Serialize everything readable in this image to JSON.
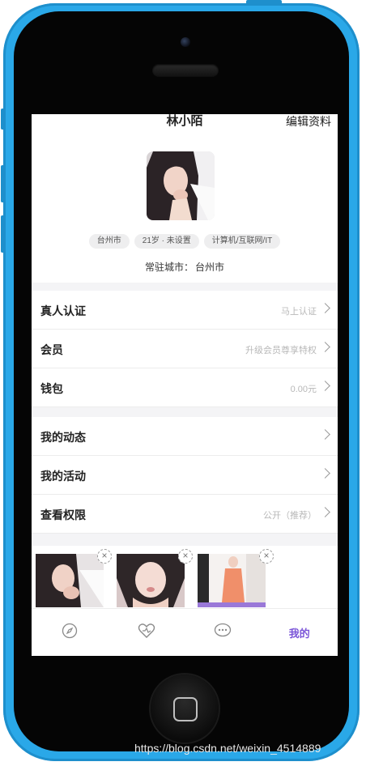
{
  "profile": {
    "name": "林小陌",
    "edit_label": "编辑资料",
    "tags": [
      "台州市",
      "21岁 · 未设置",
      "计算机/互联网/IT"
    ],
    "city_label": "常驻城市：",
    "city_value": "台州市"
  },
  "menu": [
    {
      "label": "真人认证",
      "value": "马上认证"
    },
    {
      "label": "会员",
      "value": "升级会员尊享特权"
    },
    {
      "label": "钱包",
      "value": "0.00元"
    },
    {
      "label": "我的动态",
      "value": ""
    },
    {
      "label": "我的活动",
      "value": ""
    },
    {
      "label": "查看权限",
      "value": "公开（推荐）"
    }
  ],
  "tabbar": {
    "icons": [
      "compass-icon",
      "heart-icon",
      "chat-icon"
    ],
    "active_label": "我的"
  },
  "watermark": "https://blog.csdn.net/weixin_4514889",
  "colors": {
    "phone": "#2aa8e8",
    "accent": "#7b55d8"
  }
}
